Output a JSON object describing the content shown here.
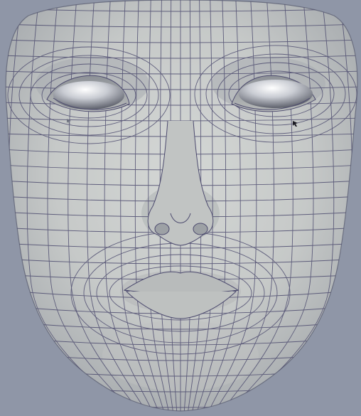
{
  "scene": {
    "background_color": "#8f96a7",
    "skin_color": "#c9cccb",
    "skin_shadow_color": "#9ea2a6",
    "wire_color": "#4c4a6e",
    "eye_color": "#e8eaef",
    "cursor_glyphs": [
      "cursor-arrow-icon",
      "cursor-arrow-icon"
    ]
  }
}
